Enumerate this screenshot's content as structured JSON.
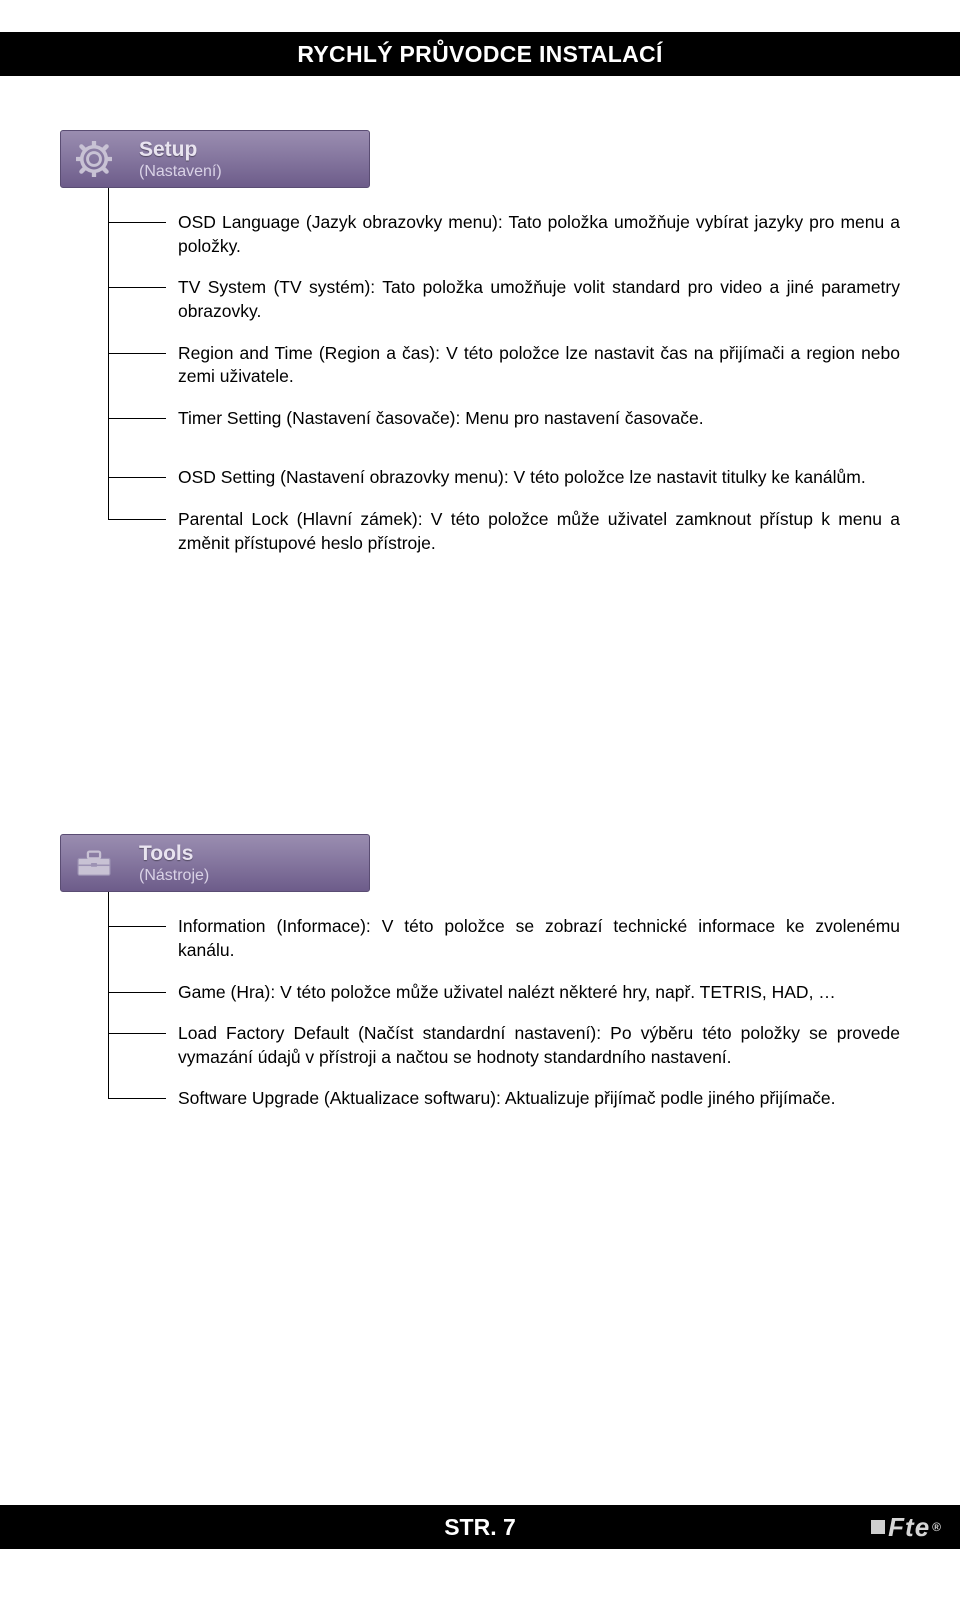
{
  "header": {
    "title": "RYCHLÝ PRŮVODCE INSTALACÍ"
  },
  "footer": {
    "text": "STR. 7",
    "logo": "Fte",
    "reg": "®"
  },
  "sections": [
    {
      "icon": "gear-icon",
      "title": "Setup",
      "subtitle": "(Nastavení)",
      "items": [
        "OSD Language (Jazyk obrazovky menu): Tato položka umožňuje vybírat jazyky pro menu a položky.",
        "TV System (TV systém): Tato položka umožňuje volit standard pro video a jiné parametry obrazovky.",
        "Region and Time (Region a čas): V této položce lze nastavit čas na přijímači a region nebo zemi uživatele.",
        "Timer Setting (Nastavení časovače): Menu pro nastavení časovače.",
        "OSD Setting (Nastavení obrazovky menu): V této položce lze nastavit titulky ke kanálům.",
        "Parental Lock (Hlavní zámek): V této položce může uživatel zamknout přístup k menu a změnit přístupové heslo přístroje."
      ],
      "gap_after_index": 3
    },
    {
      "icon": "toolbox-icon",
      "title": "Tools",
      "subtitle": "(Nástroje)",
      "items": [
        "Information (Informace): V této položce se zobrazí technické informace ke zvolenému kanálu.",
        "Game (Hra): V této položce může uživatel nalézt některé hry, např. TETRIS, HAD, …",
        "Load Factory Default (Načíst standardní nastavení): Po výběru této položky se provede vymazání údajů v přístroji a načtou se hodnoty standardního nastavení.",
        "Software Upgrade (Aktualizace softwaru): Aktualizuje přijímač podle jiného přijímače."
      ],
      "gap_after_index": -1
    }
  ]
}
